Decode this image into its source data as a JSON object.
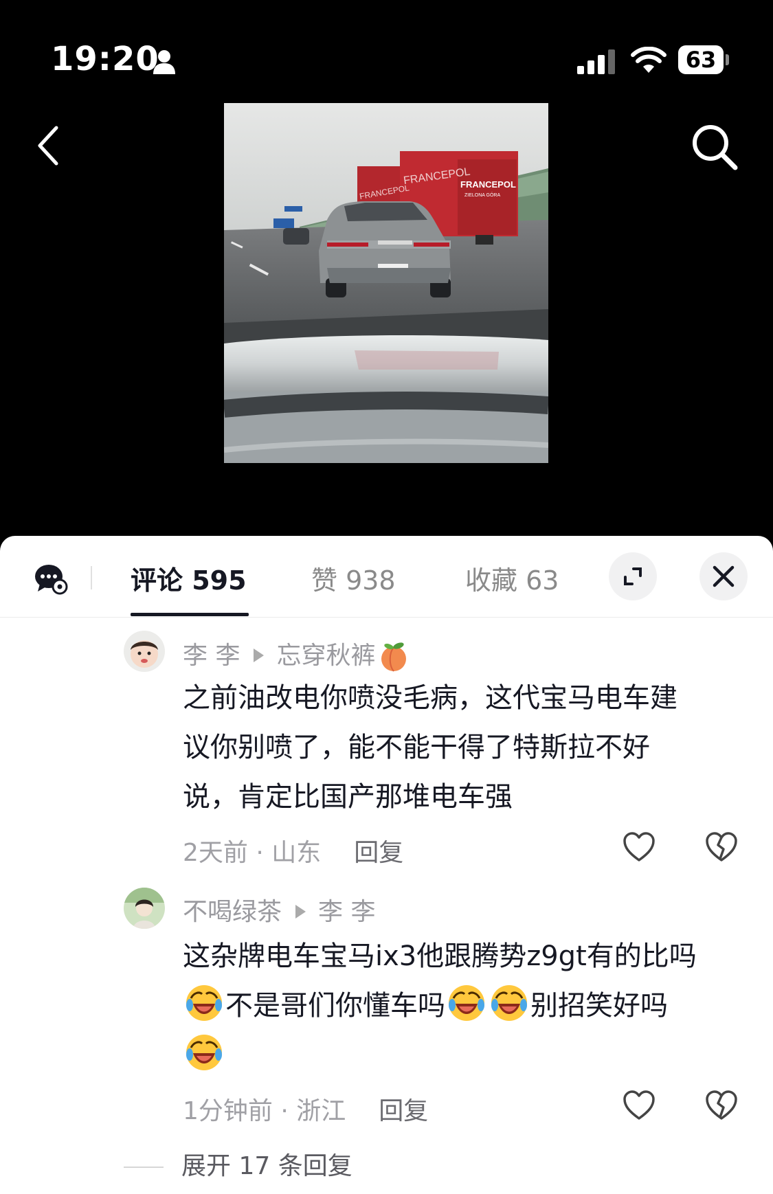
{
  "status_bar": {
    "time": "19:20",
    "battery": "63"
  },
  "tabs": {
    "comments": "评论 595",
    "likes": "赞 938",
    "favorites": "收藏 63"
  },
  "comments": [
    {
      "author": "李 李",
      "reply_to": "忘穿秋裤",
      "reply_to_emoji": "peach",
      "text_lines": [
        "之前油改电你喷没毛病，这代宝马电车建",
        "议你别喷了，能不能干得了特斯拉不好",
        "说，肯定比国产那堆电车强"
      ],
      "meta": "2天前 · 山东",
      "reply_label": "回复"
    },
    {
      "author": "不喝绿茶",
      "reply_to": "李 李",
      "text_line1": "这杂牌电车宝马ix3他跟腾势z9gt有的比吗",
      "text_line2_a": "不是哥们你懂车吗",
      "text_line2_b": "别招笑好吗",
      "emoji": "rofl-face",
      "meta": "1分钟前 · 浙江",
      "reply_label": "回复"
    }
  ],
  "expand_replies": "展开 17 条回复"
}
